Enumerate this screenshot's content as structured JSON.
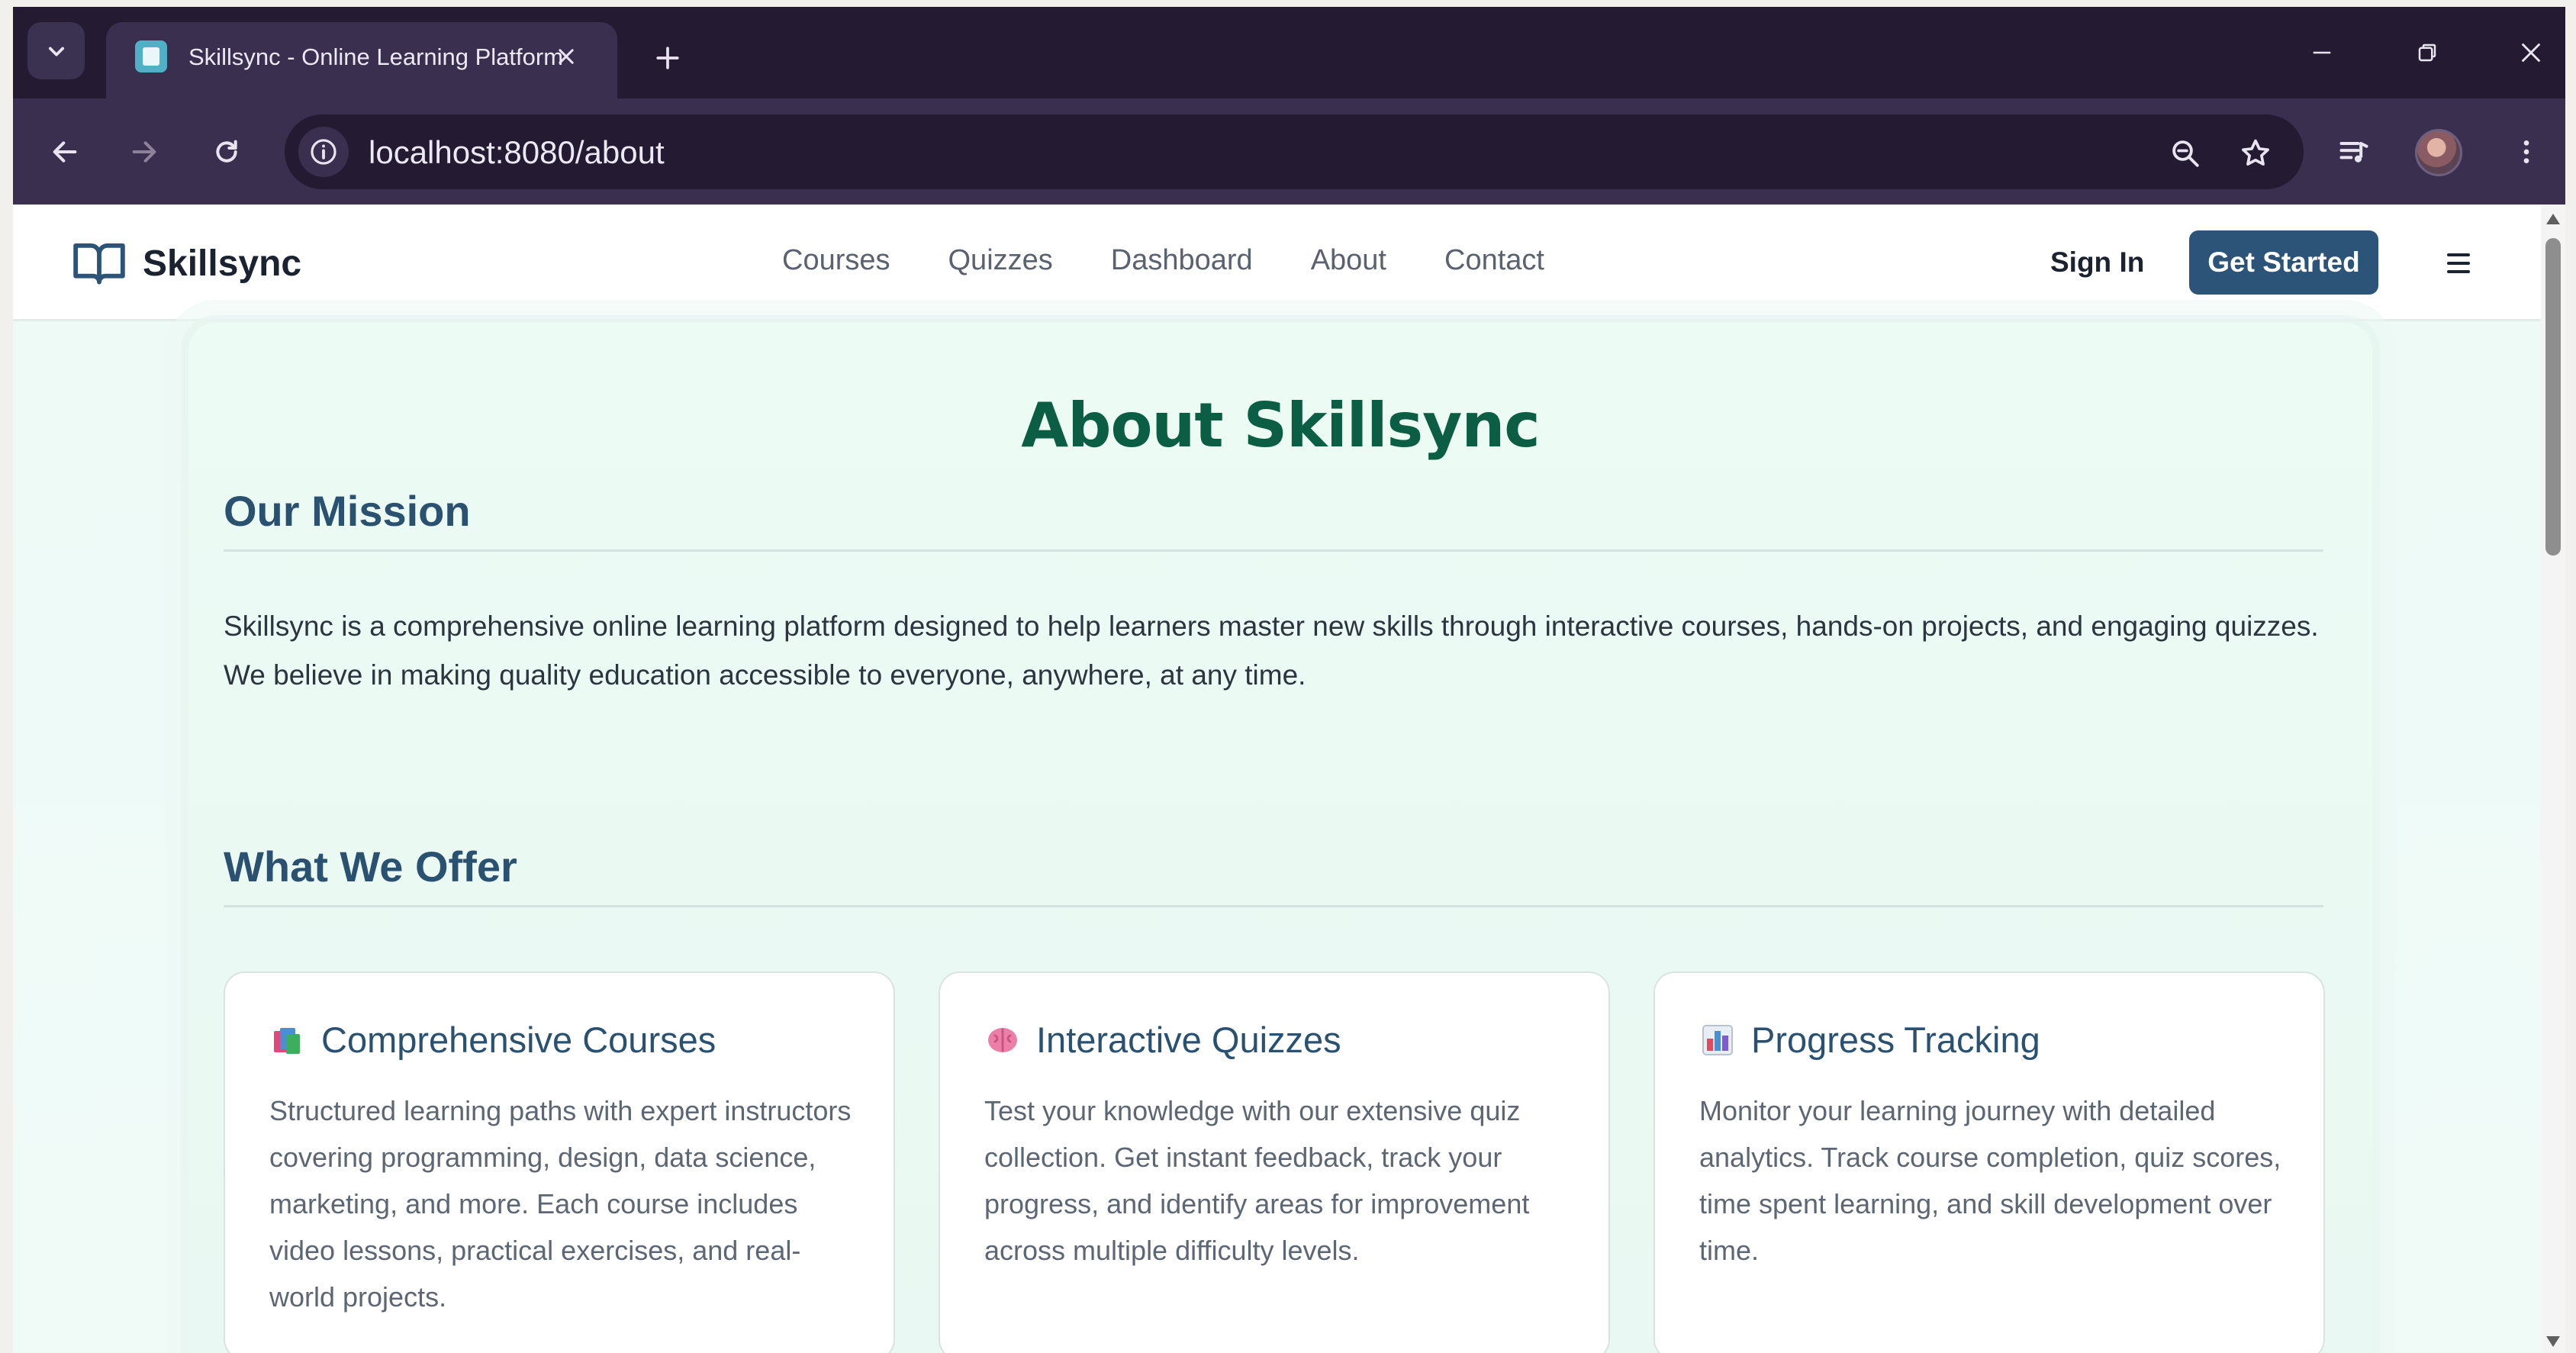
{
  "browser": {
    "tab_title": "Skillsync - Online Learning Platform",
    "url": "localhost:8080/about"
  },
  "header": {
    "logo_text": "Skillsync",
    "nav": [
      "Courses",
      "Quizzes",
      "Dashboard",
      "About",
      "Contact"
    ],
    "sign_in": "Sign In",
    "get_started": "Get Started"
  },
  "page": {
    "title": "About Skillsync",
    "mission_heading": "Our Mission",
    "mission_text": "Skillsync is a comprehensive online learning platform designed to help learners master new skills through interactive courses, hands-on projects, and engaging quizzes. We believe in making quality education accessible to everyone, anywhere, at any time.",
    "offer_heading": "What We Offer",
    "offers": [
      {
        "icon": "books-icon",
        "title": "Comprehensive Courses",
        "description": "Structured learning paths with expert instructors covering programming, design, data science, marketing, and more. Each course includes video lessons, practical exercises, and real-world projects."
      },
      {
        "icon": "brain-icon",
        "title": "Interactive Quizzes",
        "description": "Test your knowledge with our extensive quiz collection. Get instant feedback, track your progress, and identify areas for improvement across multiple difficulty levels."
      },
      {
        "icon": "bar-chart-icon",
        "title": "Progress Tracking",
        "description": "Monitor your learning journey with detailed analytics. Track course completion, quiz scores, time spent learning, and skill development over time."
      }
    ]
  },
  "colors": {
    "brand_button": "#2c5478",
    "title_green": "#0b5e43",
    "heading_blue": "#2b5171"
  }
}
